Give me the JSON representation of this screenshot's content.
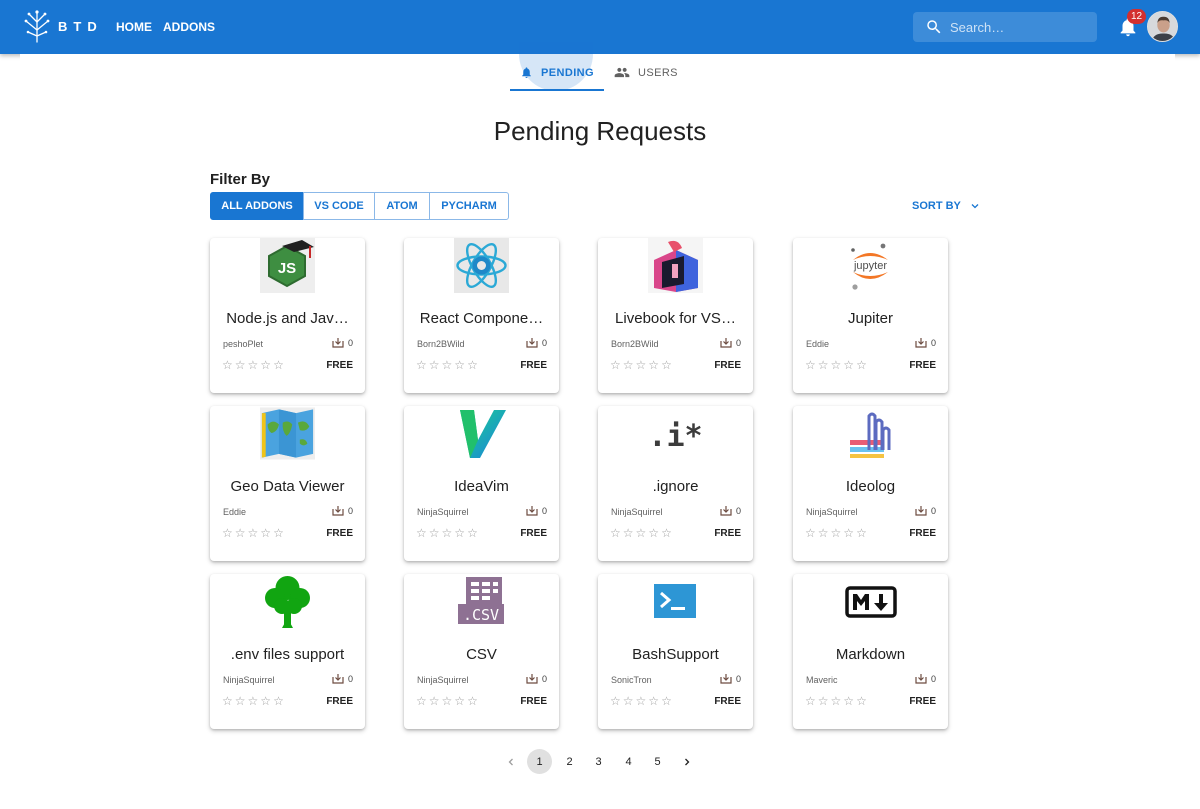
{
  "app": {
    "brand": "BTD",
    "nav": [
      "HOME",
      "ADDONS"
    ],
    "search_placeholder": "Search…",
    "notification_count": "12"
  },
  "tabs": [
    "PENDING",
    "USERS"
  ],
  "page_title": "Pending Requests",
  "filter": {
    "label": "Filter By",
    "options": [
      "ALL ADDONS",
      "VS CODE",
      "ATOM",
      "PYCHARM"
    ],
    "active": "ALL ADDONS"
  },
  "sort_label": "SORT BY",
  "addons": [
    {
      "title": "Node.js and Jav…",
      "author": "peshoPlet",
      "downloads": "0",
      "price": "FREE",
      "icon": "nodejs-icon"
    },
    {
      "title": "React Compone…",
      "author": "Born2BWild",
      "downloads": "0",
      "price": "FREE",
      "icon": "react-icon"
    },
    {
      "title": "Livebook for VS…",
      "author": "Born2BWild",
      "downloads": "0",
      "price": "FREE",
      "icon": "livebook-icon"
    },
    {
      "title": "Jupiter",
      "author": "Eddie",
      "downloads": "0",
      "price": "FREE",
      "icon": "jupyter-icon"
    },
    {
      "title": "Geo Data Viewer",
      "author": "Eddie",
      "downloads": "0",
      "price": "FREE",
      "icon": "world-map-icon"
    },
    {
      "title": "IdeaVim",
      "author": "NinjaSquirrel",
      "downloads": "0",
      "price": "FREE",
      "icon": "ideavim-icon"
    },
    {
      "title": ".ignore",
      "author": "NinjaSquirrel",
      "downloads": "0",
      "price": "FREE",
      "icon": "ignore-icon"
    },
    {
      "title": "Ideolog",
      "author": "NinjaSquirrel",
      "downloads": "0",
      "price": "FREE",
      "icon": "ideolog-icon"
    },
    {
      "title": ".env files support",
      "author": "NinjaSquirrel",
      "downloads": "0",
      "price": "FREE",
      "icon": "tree-icon"
    },
    {
      "title": "CSV",
      "author": "NinjaSquirrel",
      "downloads": "0",
      "price": "FREE",
      "icon": "csv-file-icon"
    },
    {
      "title": "BashSupport",
      "author": "SonicTron",
      "downloads": "0",
      "price": "FREE",
      "icon": "terminal-icon"
    },
    {
      "title": "Markdown",
      "author": "Maveric",
      "downloads": "0",
      "price": "FREE",
      "icon": "markdown-icon"
    }
  ],
  "rating_stars": 5,
  "pagination": {
    "pages": [
      "1",
      "2",
      "3",
      "4",
      "5"
    ],
    "current": "1"
  },
  "colors": {
    "primary": "#1976d2",
    "badge": "#d32f2f"
  }
}
